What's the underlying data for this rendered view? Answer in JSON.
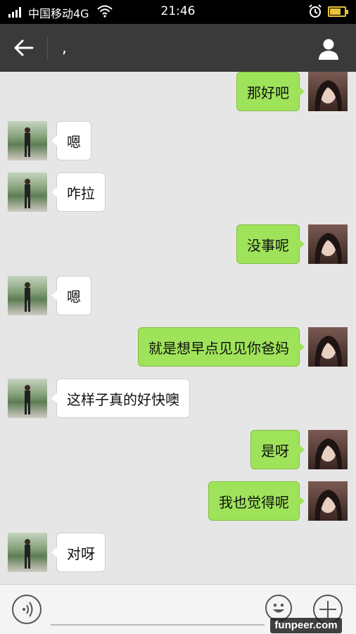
{
  "status_bar": {
    "carrier": "中国移动4G",
    "time": "21:46",
    "icons": [
      "signal-icon",
      "wifi-icon",
      "alarm-icon",
      "battery-charging-icon"
    ]
  },
  "header": {
    "title": ",",
    "back_icon": "back-arrow-icon",
    "contact_icon": "person-icon",
    "background": "#3a3a3a"
  },
  "messages": [
    {
      "direction": "out",
      "text": "那好吧"
    },
    {
      "direction": "in",
      "text": "嗯"
    },
    {
      "direction": "in",
      "text": "咋拉"
    },
    {
      "direction": "out",
      "text": "没事呢"
    },
    {
      "direction": "in",
      "text": "嗯"
    },
    {
      "direction": "out",
      "text": "就是想早点见见你爸妈"
    },
    {
      "direction": "in",
      "text": "这样子真的好快噢"
    },
    {
      "direction": "out",
      "text": "是呀"
    },
    {
      "direction": "out",
      "text": "我也觉得呢"
    },
    {
      "direction": "in",
      "text": "对呀"
    }
  ],
  "input_bar": {
    "voice_icon": "voice-icon",
    "emoji_icon": "emoji-icon",
    "plus_icon": "plus-icon"
  },
  "watermark": "funpeer.com",
  "colors": {
    "outgoing_bubble": "#9fe35a",
    "incoming_bubble": "#ffffff",
    "chat_background": "#e6e6e6"
  }
}
